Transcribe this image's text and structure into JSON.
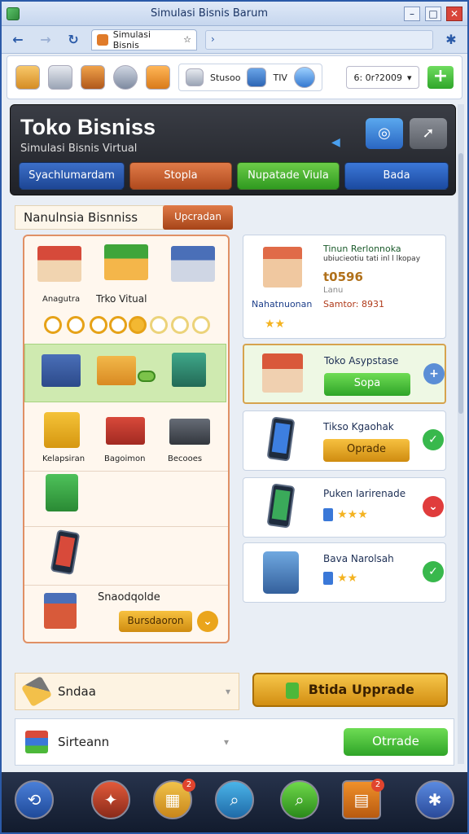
{
  "window": {
    "title": "Simulasi Bisnis Barum"
  },
  "tab": {
    "label": "Simulasi Bisnis",
    "star": "☆"
  },
  "address": {
    "value": "›"
  },
  "toolbar": {
    "text1": "Stusoo",
    "text2": "TIV",
    "date": "6: 0r?2009",
    "add": "+"
  },
  "header": {
    "title": "Toko Bisniss",
    "subtitle": "Simulasi Bisnis Virtual",
    "buttons": [
      "Syachlumardam",
      "Stopla",
      "Nupatade Viula",
      "Bada"
    ]
  },
  "section": {
    "title": "Nanulnsia Bisnniss",
    "button": "Upcradan"
  },
  "leftpanel": {
    "labels1": [
      "Anagutra",
      "Trko Vitual"
    ],
    "labels3": [
      "Kelapsiran",
      "Bagoimon",
      "Becooes"
    ],
    "label_bottom": "Snaodqolde",
    "btn_bottom": "Bursdaoron"
  },
  "cards": [
    {
      "title": "Tinun Rerlonnoka",
      "desc": "ubiucieotiu tati inl l lkopay",
      "value": "t0596",
      "unit": "Lanu",
      "name": "Nahatnuonan",
      "price": "Samtor: 8931"
    },
    {
      "title": "Toko Asypstase",
      "button": "Sopa"
    },
    {
      "title": "Tikso Kgaohak",
      "button": "Oprade"
    },
    {
      "title": "Puken Iarirenade"
    },
    {
      "title": "Bava Narolsah"
    }
  ],
  "bottom": {
    "row1": "Sndaa",
    "big_button": "Btida Upprade",
    "row2": "Sirteann",
    "otrade": "Otrrade"
  },
  "taskbar": {
    "badge1": "2",
    "badge2": "2"
  },
  "colors": {
    "accent_green": "#2fa428",
    "accent_orange": "#d97a1a",
    "accent_blue": "#2a66c2",
    "header_dark": "#23262d"
  }
}
